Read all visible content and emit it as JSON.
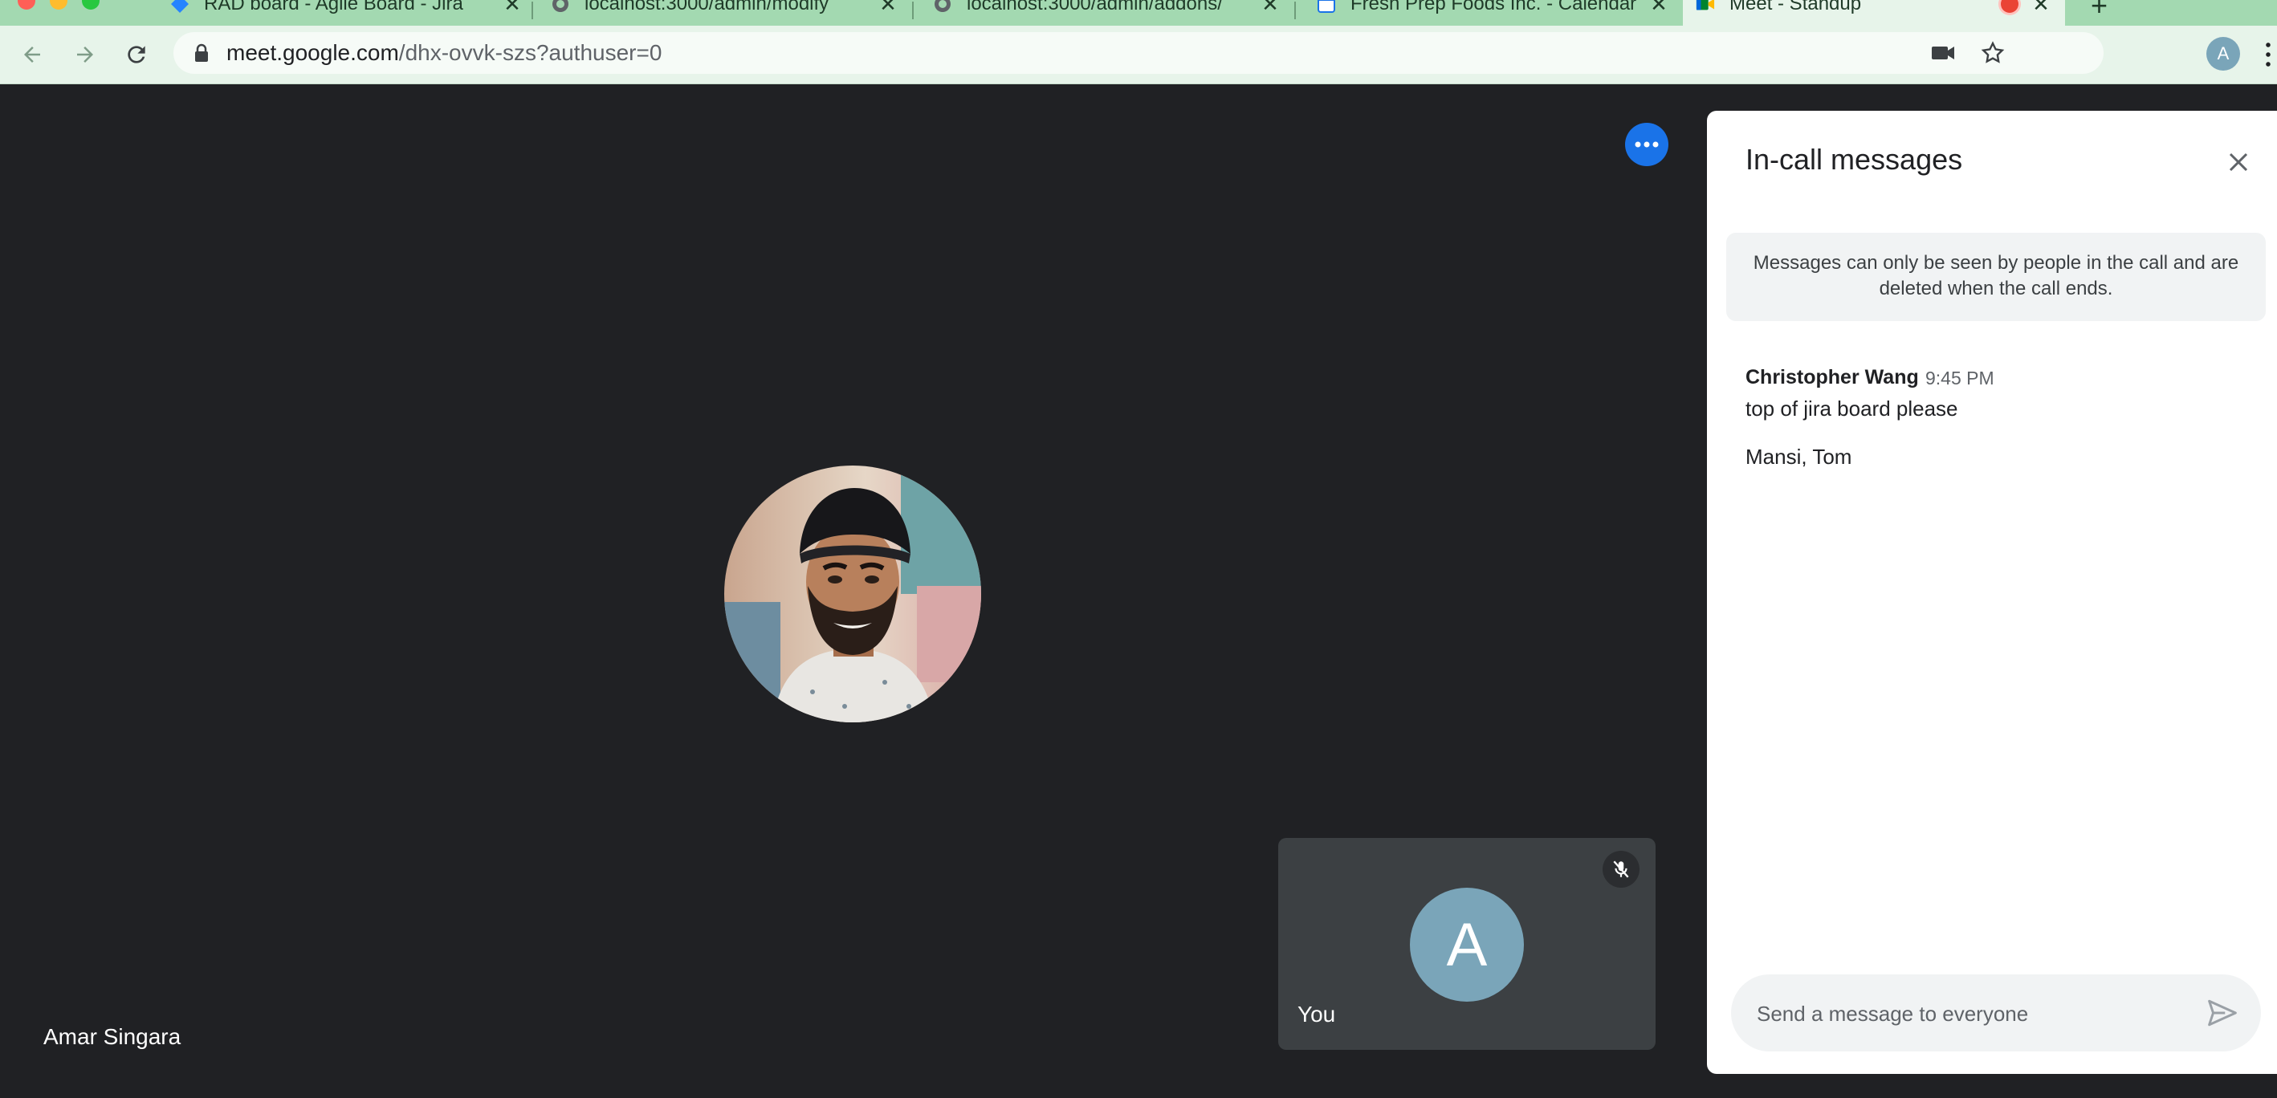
{
  "browser": {
    "tabs": [
      {
        "title": "RAD board - Agile Board - Jira",
        "icon": "jira-icon"
      },
      {
        "title": "localhost:3000/admin/modify",
        "icon": "globe-icon"
      },
      {
        "title": "localhost:3000/admin/addons/",
        "icon": "globe-icon"
      },
      {
        "title": "Fresh Prep Foods Inc. - Calendar",
        "icon": "calendar-icon"
      },
      {
        "title": "Meet - Standup",
        "icon": "meet-icon",
        "active": true
      }
    ],
    "url": {
      "host": "meet.google.com",
      "path": "/dhx-ovvk-szs?authuser=0"
    },
    "profile_initial": "A"
  },
  "meeting": {
    "presenter_name": "Amar Singara",
    "self_initial": "A",
    "self_label": "You",
    "self_mic": "mic-off-icon"
  },
  "chat": {
    "title": "In-call messages",
    "notice": "Messages can only be seen by people in the call and are deleted when the call ends.",
    "messages": [
      {
        "sender": "Christopher Wang",
        "time": "9:45 PM",
        "lines": [
          "top of jira board please",
          "Mansi, Tom"
        ]
      }
    ],
    "input_placeholder": "Send a message to everyone"
  },
  "colors": {
    "tabbar": "#a3d9b1",
    "toolbar": "#e7f4ea",
    "stage": "#202124",
    "accent": "#1a73e8",
    "self_avatar": "#7aa5b9"
  }
}
